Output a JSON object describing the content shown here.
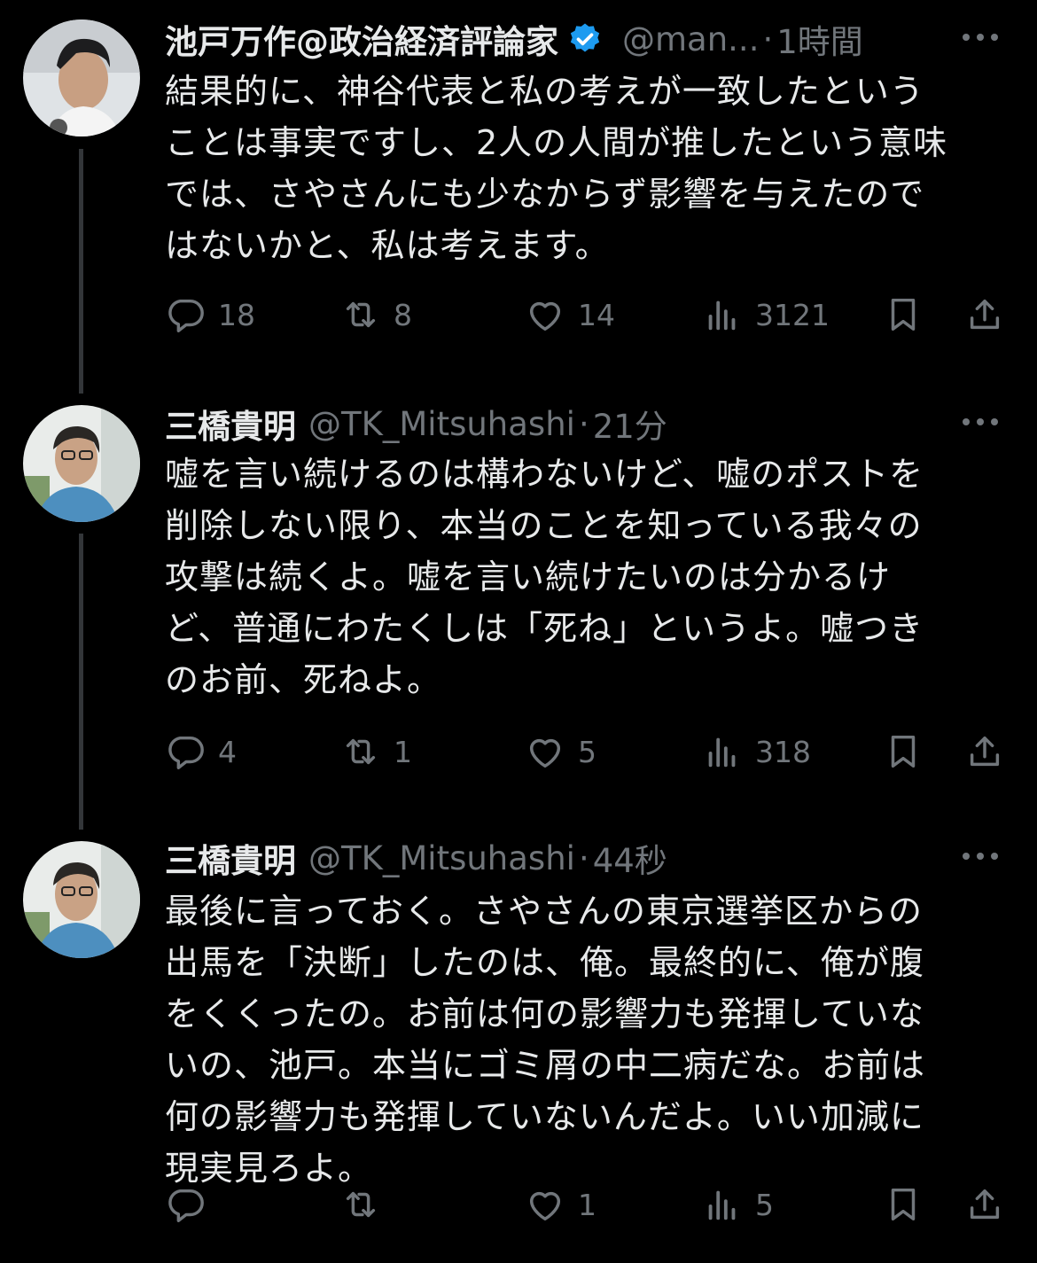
{
  "tweets": [
    {
      "name": "池戸万作@政治経済評論家",
      "verified": true,
      "handle": "@man...",
      "dot": "·",
      "time": "1時間",
      "text": "結果的に、神谷代表と私の考えが一致したという\nことは事実ですし、2人の人間が推したという意味\nでは、さやさんにも少なからず影響を与えたので\nはないかと、私は考えます。",
      "replies": "18",
      "reposts": "8",
      "likes": "14",
      "views": "3121"
    },
    {
      "name": "三橋貴明",
      "verified": false,
      "handle": "@TK_Mitsuhashi",
      "dot": "·",
      "time": "21分",
      "text": "嘘を言い続けるのは構わないけど、嘘のポストを\n削除しない限り、本当のことを知っている我々の\n攻撃は続くよ。嘘を言い続けたいのは分かるけ\nど、普通にわたくしは「死ね」というよ。嘘つき\nのお前、死ねよ。",
      "replies": "4",
      "reposts": "1",
      "likes": "5",
      "views": "318"
    },
    {
      "name": "三橋貴明",
      "verified": false,
      "handle": "@TK_Mitsuhashi",
      "dot": "·",
      "time": "44秒",
      "text": "最後に言っておく。さやさんの東京選挙区からの\n出馬を「決断」したのは、俺。最終的に、俺が腹\nをくくったの。お前は何の影響力も発揮していな\nいの、池戸。本当にゴミ屑の中二病だな。お前は\n何の影響力も発揮していないんだよ。いい加減に\n現実見ろよ。",
      "replies": "",
      "reposts": "",
      "likes": "1",
      "views": "5"
    }
  ],
  "colors": {
    "background": "#000000",
    "text": "#e7e9ea",
    "muted": "#71767b",
    "verified": "#1d9bf0"
  },
  "icons": [
    "reply-icon",
    "repost-icon",
    "like-icon",
    "views-icon",
    "bookmark-icon",
    "share-icon",
    "more-icon",
    "verified-icon"
  ]
}
